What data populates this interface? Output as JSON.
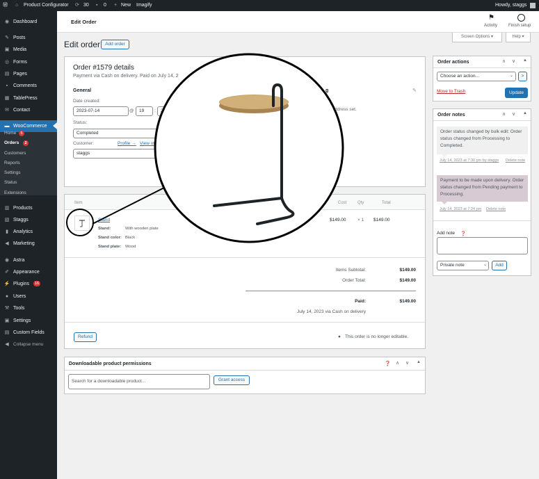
{
  "admin_bar": {
    "site_name": "Product Configurator",
    "updates_count": "30",
    "comments_count": "0",
    "new_label": "New",
    "plugin_label": "Imagify",
    "greeting": "Howdy, staggs"
  },
  "sidebar": {
    "items": [
      {
        "label": "Dashboard",
        "icon": "dashboard-icon"
      },
      {
        "label": "Posts",
        "icon": "pin-icon"
      },
      {
        "label": "Media",
        "icon": "media-icon"
      },
      {
        "label": "Forms",
        "icon": "forms-icon"
      },
      {
        "label": "Pages",
        "icon": "page-icon"
      },
      {
        "label": "Comments",
        "icon": "comment-icon"
      },
      {
        "label": "TablePress",
        "icon": "table-icon"
      },
      {
        "label": "Contact",
        "icon": "mail-icon"
      },
      {
        "label": "WooCommerce",
        "icon": "woo-icon"
      }
    ],
    "woo_sub": [
      {
        "label": "Home",
        "badge": "5"
      },
      {
        "label": "Orders",
        "badge": "2"
      },
      {
        "label": "Customers",
        "badge": ""
      },
      {
        "label": "Reports",
        "badge": ""
      },
      {
        "label": "Settings",
        "badge": ""
      },
      {
        "label": "Status",
        "badge": ""
      },
      {
        "label": "Extensions",
        "badge": ""
      }
    ],
    "items2": [
      {
        "label": "Products",
        "icon": "products-icon",
        "badge": ""
      },
      {
        "label": "Staggs",
        "icon": "staggs-icon",
        "badge": ""
      },
      {
        "label": "Analytics",
        "icon": "chart-icon",
        "badge": ""
      },
      {
        "label": "Marketing",
        "icon": "megaphone-icon",
        "badge": ""
      },
      {
        "label": "Astra",
        "icon": "astra-icon",
        "badge": ""
      },
      {
        "label": "Appearance",
        "icon": "brush-icon",
        "badge": ""
      },
      {
        "label": "Plugins",
        "icon": "plugin-icon",
        "badge": "16"
      },
      {
        "label": "Users",
        "icon": "user-icon",
        "badge": ""
      },
      {
        "label": "Tools",
        "icon": "wrench-icon",
        "badge": ""
      },
      {
        "label": "Settings",
        "icon": "settings-icon",
        "badge": ""
      },
      {
        "label": "Custom Fields",
        "icon": "fields-icon",
        "badge": ""
      },
      {
        "label": "Collapse menu",
        "icon": "collapse-icon",
        "badge": ""
      }
    ]
  },
  "topbar": {
    "title": "Edit Order",
    "activity_label": "Activity",
    "finish_setup_label": "Finish setup"
  },
  "screen_options_label": "Screen Options ▾",
  "help_label": "Help ▾",
  "page": {
    "heading": "Edit order",
    "add_order_label": "Add order"
  },
  "order": {
    "title": "Order #1579 details",
    "subtitle": "Payment via Cash on delivery. Paid on July 14, 2",
    "general_heading": "General",
    "date_created_label": "Date created:",
    "date_value": "2023-07-14",
    "at_symbol": "@",
    "hour": "19",
    "minute": "2",
    "status_label": "Status:",
    "status_value": "Completed",
    "customer_label": "Customer:",
    "profile_link": "Profile →",
    "view_link": "View ot",
    "customer_value": "staggs",
    "shipping_heading_fragment": "g",
    "address_fragment": "ddress set."
  },
  "items_table": {
    "headers": {
      "item": "Item",
      "cost": "Cost",
      "qty": "Qty",
      "total": "Total"
    },
    "row": {
      "name": "Stand",
      "meta": [
        {
          "key": "Stand:",
          "value": "With wooden plate"
        },
        {
          "key": "Stand color:",
          "value": "Black"
        },
        {
          "key": "Stand plate:",
          "value": "Wood"
        }
      ],
      "cost": "$149.00",
      "qty": "× 1",
      "total": "$149.00"
    },
    "totals": {
      "subtotal_label": "Items Subtotal:",
      "subtotal_value": "$149.00",
      "order_total_label": "Order Total:",
      "order_total_value": "$149.00",
      "paid_label": "Paid:",
      "paid_value": "$149.00",
      "paid_note": "July 14, 2023 via Cash on delivery"
    },
    "refund_label": "Refund",
    "not_editable": "This order is no longer editable."
  },
  "downloads": {
    "title": "Downloadable product permissions",
    "search_placeholder": "Search for a downloadable product...",
    "grant_label": "Grant access"
  },
  "order_actions": {
    "title": "Order actions",
    "select_value": "Choose an action...",
    "go_label": ">",
    "trash_label": "Move to Trash",
    "update_label": "Update"
  },
  "order_notes": {
    "title": "Order notes",
    "notes": [
      {
        "text": "Order status changed by bulk edit: Order status changed from Processing to Completed.",
        "meta": "July 14, 2023 at 7:30 pm by staggs",
        "delete": "Delete note"
      },
      {
        "text": "Payment to be made upon delivery. Order status changed from Pending payment to Processing.",
        "meta": "July 14, 2023 at 7:24 pm",
        "delete": "Delete note"
      }
    ],
    "add_note_label": "Add note",
    "note_type": "Private note",
    "add_button": "Add"
  },
  "colors": {
    "admin_dark": "#1d2327",
    "accent": "#2271b1",
    "active_menu": "#2271b1",
    "customer_note_bg": "#d7cad2",
    "system_note_bg": "#f0f0f1",
    "danger": "#d63638"
  }
}
